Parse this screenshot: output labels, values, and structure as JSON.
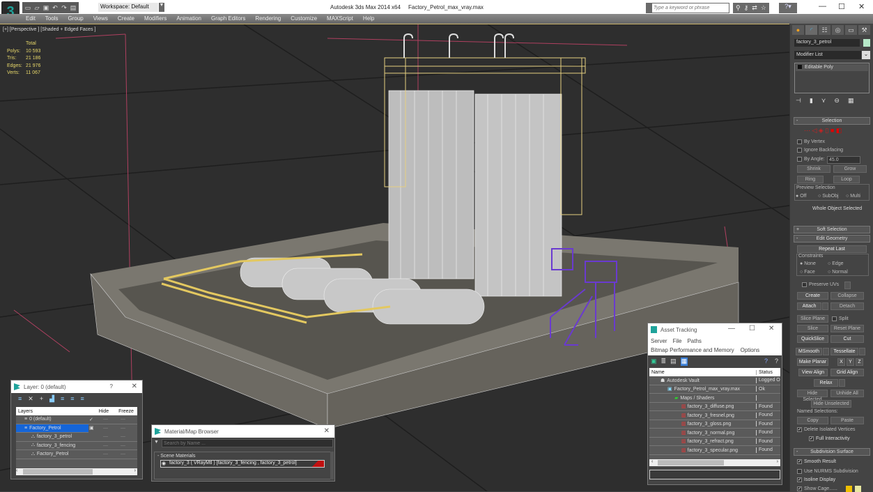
{
  "app": {
    "title": "Autodesk 3ds Max  2014 x64",
    "file": "Factory_Petrol_max_vray.max"
  },
  "toolbar": {
    "workspace": "Workspace: Default",
    "search_placeholder": "Type a keyword or phrase"
  },
  "menu": [
    "Edit",
    "Tools",
    "Group",
    "Views",
    "Create",
    "Modifiers",
    "Animation",
    "Graph Editors",
    "Rendering",
    "Customize",
    "MAXScript",
    "Help"
  ],
  "viewport": {
    "label": "[+] [Perspective ] [Shaded + Edged Faces ]",
    "stats": {
      "header": "Total",
      "rows": [
        {
          "k": "Polys:",
          "v": "10 593"
        },
        {
          "k": "Tris:",
          "v": "21 186"
        },
        {
          "k": "Edges:",
          "v": "21 976"
        },
        {
          "k": "Verts:",
          "v": "11 067"
        }
      ]
    }
  },
  "command_panel": {
    "object_name": "factory_3_petrol",
    "object_color": "#b6e8c8",
    "modifier_list": "Modifier List",
    "stack_item": "Editable Poly",
    "selection": {
      "title": "Selection",
      "by_vertex": "By Vertex",
      "ignore_backfacing": "Ignore Backfacing",
      "by_angle": "By Angle:",
      "angle": "45.0",
      "shrink": "Shrink",
      "grow": "Grow",
      "ring": "Ring",
      "loop": "Loop",
      "preview": "Preview Selection",
      "off": "Off",
      "subobj": "SubObj",
      "multi": "Multi",
      "status": "Whole Object Selected"
    },
    "soft_selection": "Soft Selection",
    "edit_geometry": {
      "title": "Edit Geometry",
      "repeat_last": "Repeat Last",
      "constraints": "Constraints",
      "none": "None",
      "edge": "Edge",
      "face": "Face",
      "normal": "Normal",
      "preserve_uvs": "Preserve UVs",
      "create": "Create",
      "collapse": "Collapse",
      "attach": "Attach",
      "detach": "Detach",
      "slice_plane": "Slice Plane",
      "split": "Split",
      "slice": "Slice",
      "reset_plane": "Reset Plane",
      "quickslice": "QuickSlice",
      "cut": "Cut",
      "msmooth": "MSmooth",
      "tessellate": "Tessellate",
      "make_planar": "Make Planar",
      "x": "X",
      "y": "Y",
      "z": "Z",
      "view_align": "View Align",
      "grid_align": "Grid Align",
      "relax": "Relax",
      "hide_selected": "Hide Selected",
      "unhide_all": "Unhide All",
      "hide_unselected": "Hide Unselected",
      "named_selections": "Named Selections:",
      "copy": "Copy",
      "paste": "Paste",
      "delete_isolated": "Delete Isolated Vertices",
      "full_interactivity": "Full Interactivity"
    },
    "subdivision": {
      "title": "Subdivision Surface",
      "smooth_result": "Smooth Result",
      "use_nurms": "Use NURMS Subdivision",
      "isoline": "Isoline Display",
      "show_cage": "Show Cage......"
    }
  },
  "asset_tracking": {
    "title": "Asset Tracking",
    "menu1": [
      "Server",
      "File",
      "Paths"
    ],
    "menu2": [
      "Bitmap Performance and Memory",
      "Options"
    ],
    "columns": [
      "Name",
      "Status"
    ],
    "rows": [
      {
        "name": "Autodesk Vault",
        "status": "Logged O"
      },
      {
        "name": "Factory_Petrol_max_vray.max",
        "status": "Ok"
      },
      {
        "name": "Maps / Shaders",
        "status": ""
      },
      {
        "name": "factory_3_diffuse.png",
        "status": "Found"
      },
      {
        "name": "factory_3_fresnel.png",
        "status": "Found"
      },
      {
        "name": "factory_3_gloss.png",
        "status": "Found"
      },
      {
        "name": "factory_3_normal.png",
        "status": "Found"
      },
      {
        "name": "factory_3_refract.png",
        "status": "Found"
      },
      {
        "name": "factory_3_specular.png",
        "status": "Found"
      }
    ]
  },
  "layers": {
    "title": "Layer: 0 (default)",
    "help": "?",
    "columns": [
      "Layers",
      "Hide",
      "Freeze"
    ],
    "rows": [
      {
        "name": "0 (default)"
      },
      {
        "name": "Factory_Petrol"
      },
      {
        "name": "factory_3_petrol"
      },
      {
        "name": "factory_3_fencing"
      },
      {
        "name": "Factory_Petrol"
      }
    ]
  },
  "material_browser": {
    "title": "Material/Map Browser",
    "search_placeholder": "Search by Name ...",
    "section": "- Scene Materials",
    "item": "factory_3  ( VRayMtl )  [factory_3_fencing , factory_3_petrol]"
  }
}
